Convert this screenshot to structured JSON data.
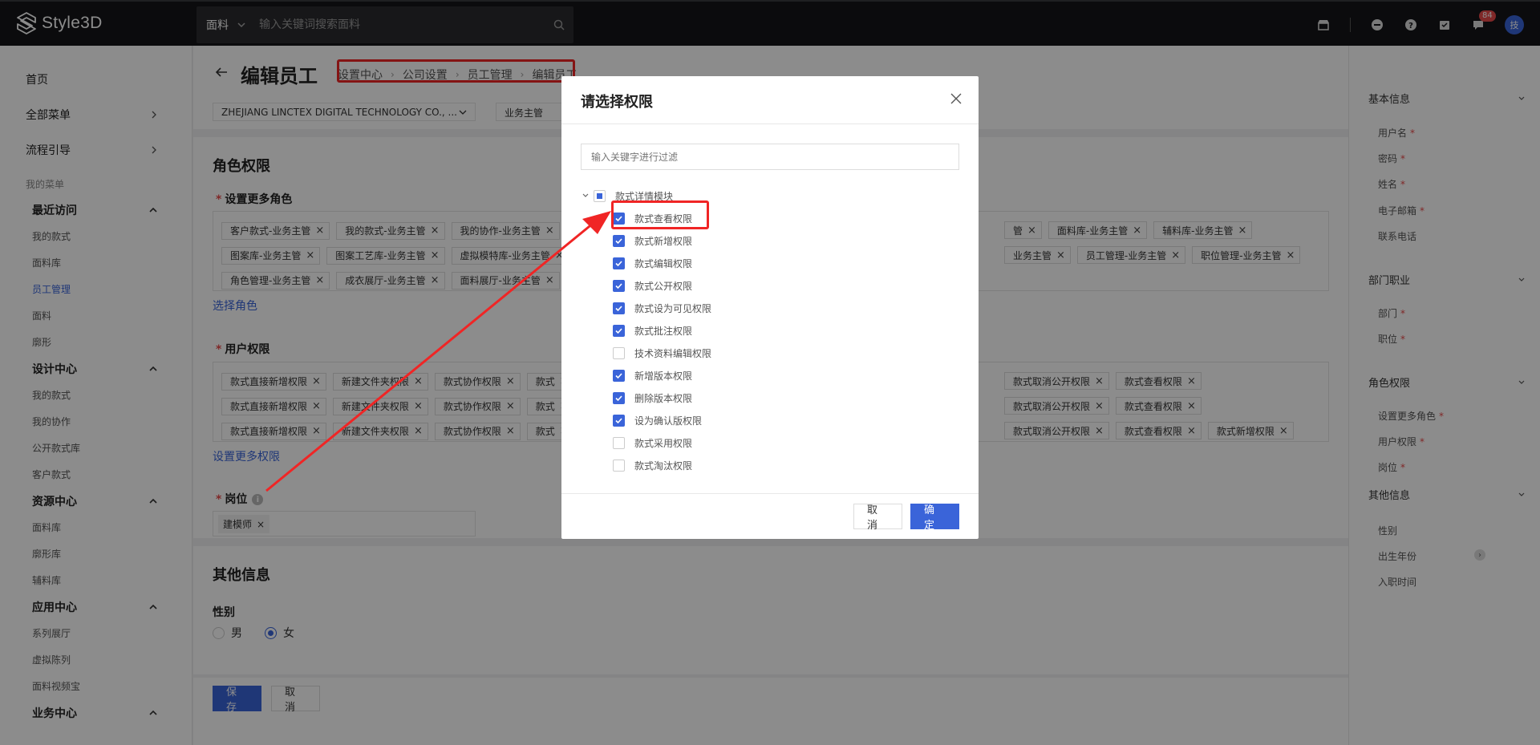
{
  "topbar": {
    "logo_text": "Style3D",
    "search_category": "面料",
    "search_placeholder": "输入关键词搜索面料",
    "message_badge": "84",
    "avatar_text": "技"
  },
  "sidebar": {
    "top_items": [
      "首页",
      "全部菜单",
      "流程引导"
    ],
    "my_menu_label": "我的菜单",
    "groups": [
      {
        "label": "最近访问",
        "items": [
          "我的款式",
          "面料库",
          "员工管理",
          "面料",
          "廓形"
        ]
      },
      {
        "label": "设计中心",
        "items": [
          "我的款式",
          "我的协作",
          "公开款式库",
          "客户款式"
        ]
      },
      {
        "label": "资源中心",
        "items": [
          "面料库",
          "廓形库",
          "辅料库"
        ]
      },
      {
        "label": "应用中心",
        "items": [
          "系列展厅",
          "虚拟陈列",
          "面料视频宝"
        ]
      },
      {
        "label": "业务中心",
        "items": []
      }
    ],
    "active_item": "员工管理"
  },
  "page": {
    "title": "编辑员工",
    "breadcrumb": [
      "设置中心",
      "公司设置",
      "员工管理",
      "编辑员工"
    ],
    "company_value": "ZHEJIANG LINCTEX DIGITAL TECHNOLOGY CO., ...",
    "role_value": "业务主管",
    "role_section_title": "角色权限",
    "more_roles_label": "设置更多角色",
    "role_tags": [
      [
        "客户款式-业务主管",
        "我的款式-业务主管",
        "我的协作-业务主管"
      ],
      [
        "图案库-业务主管",
        "图案工艺库-业务主管",
        "虚拟模特库-业务主管"
      ],
      [
        "角色管理-业务主管",
        "成衣展厅-业务主管",
        "面料展厅-业务主管"
      ]
    ],
    "role_tags_right": [
      [
        "管",
        "面料库-业务主管",
        "辅料库-业务主管"
      ],
      [
        "业务主管",
        "员工管理-业务主管",
        "职位管理-业务主管"
      ],
      []
    ],
    "select_role_link": "选择角色",
    "user_perm_label": "用户权限",
    "perm_tags": [
      [
        "款式直接新增权限",
        "新建文件夹权限",
        "款式协作权限",
        "款式"
      ],
      [
        "款式直接新增权限",
        "新建文件夹权限",
        "款式协作权限",
        "款式"
      ],
      [
        "款式直接新增权限",
        "新建文件夹权限",
        "款式协作权限",
        "款式"
      ]
    ],
    "perm_tags_right": [
      [
        "款式取消公开权限",
        "款式查看权限"
      ],
      [
        "款式取消公开权限",
        "款式查看权限"
      ],
      [
        "款式取消公开权限",
        "款式查看权限",
        "款式新增权限"
      ]
    ],
    "more_perms_link": "设置更多权限",
    "position_label": "岗位",
    "position_tag": "建模师",
    "other_section_title": "其他信息",
    "gender_label": "性别",
    "gender_options": [
      "男",
      "女"
    ],
    "gender_selected": "女",
    "save_label": "保存",
    "cancel_label": "取消"
  },
  "rail": {
    "groups": [
      {
        "label": "基本信息",
        "items": [
          {
            "t": "用户名",
            "req": true
          },
          {
            "t": "密码",
            "req": true
          },
          {
            "t": "姓名",
            "req": true
          },
          {
            "t": "电子邮箱",
            "req": true
          },
          {
            "t": "联系电话",
            "req": false
          }
        ]
      },
      {
        "label": "部门职业",
        "items": [
          {
            "t": "部门",
            "req": true
          },
          {
            "t": "职位",
            "req": true
          }
        ]
      },
      {
        "label": "角色权限",
        "items": [
          {
            "t": "设置更多角色",
            "req": true
          },
          {
            "t": "用户权限",
            "req": true
          },
          {
            "t": "岗位",
            "req": true
          }
        ]
      },
      {
        "label": "其他信息",
        "items": [
          {
            "t": "性别",
            "req": false
          },
          {
            "t": "出生年份",
            "req": false
          },
          {
            "t": "入职时间",
            "req": false
          }
        ]
      }
    ]
  },
  "modal": {
    "title": "请选择权限",
    "filter_placeholder": "输入关键字进行过滤",
    "root_label": "款式详情模块",
    "children": [
      {
        "label": "款式查看权限",
        "checked": true
      },
      {
        "label": "款式新增权限",
        "checked": true
      },
      {
        "label": "款式编辑权限",
        "checked": true
      },
      {
        "label": "款式公开权限",
        "checked": true
      },
      {
        "label": "款式设为可见权限",
        "checked": true
      },
      {
        "label": "款式批注权限",
        "checked": true
      },
      {
        "label": "技术资料编辑权限",
        "checked": false
      },
      {
        "label": "新增版本权限",
        "checked": true
      },
      {
        "label": "删除版本权限",
        "checked": true
      },
      {
        "label": "设为确认版权限",
        "checked": true
      },
      {
        "label": "款式采用权限",
        "checked": false
      },
      {
        "label": "款式淘汰权限",
        "checked": false
      }
    ],
    "cancel_label": "取 消",
    "confirm_label": "确 定"
  },
  "colors": {
    "accent": "#3a64d9",
    "annotation": "#f02525",
    "topbar": "#141518"
  }
}
